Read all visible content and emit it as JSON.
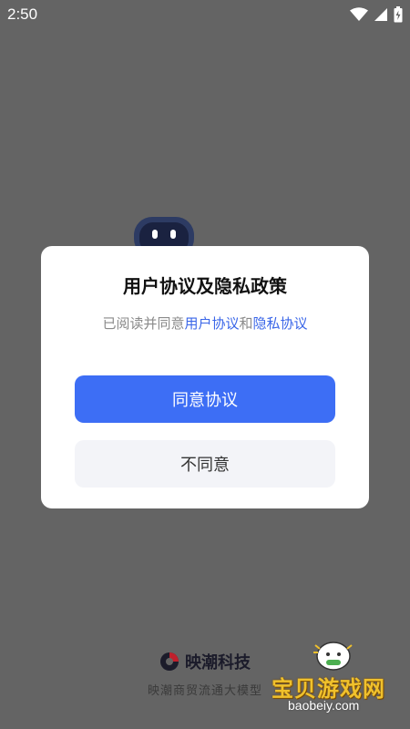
{
  "status_bar": {
    "time": "2:50",
    "icons": [
      "wifi-icon",
      "cell-signal-icon",
      "battery-charging-icon"
    ]
  },
  "dialog": {
    "title": "用户协议及隐私政策",
    "desc_prefix": "已阅读并同意",
    "user_agreement_link": "用户协议",
    "conjunction": "和",
    "privacy_link": "隐私协议",
    "agree_button": "同意协议",
    "disagree_button": "不同意"
  },
  "splash": {
    "brand_name": "映潮科技",
    "tagline": "映潮商贸流通大模型"
  },
  "watermark": {
    "title": "宝贝游戏网",
    "url": "baobeiy.com"
  },
  "colors": {
    "overlay": "#646464",
    "accent": "#3d6ef5",
    "link": "#3a66e8",
    "secondary_button_bg": "#f3f4f8"
  }
}
